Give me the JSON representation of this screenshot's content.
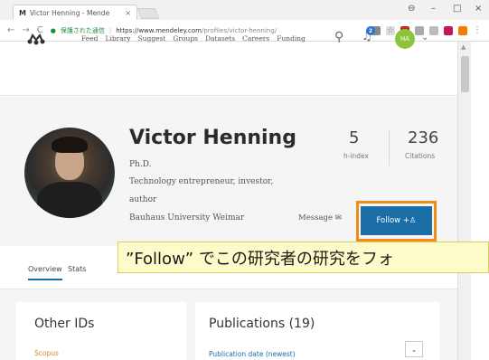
{
  "browser": {
    "tab_title": "Victor Henning - Mende",
    "tab_favicon": "M",
    "url_secure": "保護された通信",
    "url_host": "https://www.mendeley.com",
    "url_path": "/profiles/victor-henning/"
  },
  "nav": {
    "links": [
      "Feed",
      "Library",
      "Suggest",
      "Groups",
      "Datasets",
      "Careers",
      "Funding"
    ],
    "notification_count": "2",
    "user_initials": "HA"
  },
  "profile": {
    "name": "Victor Henning",
    "degree": "Ph.D.",
    "bio_line1": "Technology entrepreneur, investor,",
    "bio_line2": "author",
    "affiliation": "Bauhaus University Weimar",
    "h_index": "5",
    "h_index_label": "h-index",
    "citations": "236",
    "citations_label": "Citations",
    "message_label": "Message",
    "follow_label": "Follow"
  },
  "tabs": [
    "Overview",
    "Stats"
  ],
  "callout": "”Follow” でこの研究者の研究をフォ",
  "cards": {
    "other_ids_title": "Other IDs",
    "scopus_label": "Scopus",
    "publications_title": "Publications (19)",
    "sort_label": "Publication date (newest)"
  }
}
